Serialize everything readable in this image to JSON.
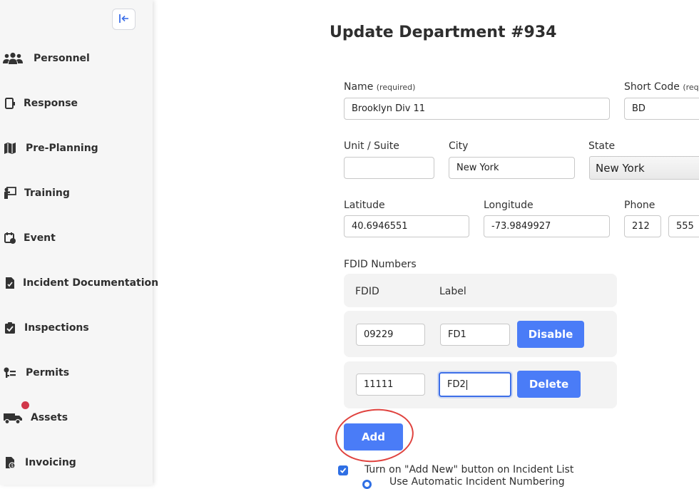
{
  "sidebar": {
    "collapse_icon": "collapse-left-icon",
    "items": [
      {
        "label": "Personnel",
        "icon": "people-icon"
      },
      {
        "label": "Response",
        "icon": "response-icon"
      },
      {
        "label": "Pre-Planning",
        "icon": "map-icon"
      },
      {
        "label": "Training",
        "icon": "training-icon"
      },
      {
        "label": "Event",
        "icon": "calendar-icon"
      },
      {
        "label": "Incident Documentation",
        "icon": "document-icon"
      },
      {
        "label": "Inspections",
        "icon": "clipboard-check-icon"
      },
      {
        "label": "Permits",
        "icon": "key-list-icon"
      },
      {
        "label": "Assets",
        "icon": "truck-icon"
      },
      {
        "label": "Invoicing",
        "icon": "invoice-icon"
      }
    ],
    "assets_badge_color": "#d1374a"
  },
  "page": {
    "title": "Update Department #934"
  },
  "form": {
    "name_label": "Name",
    "name_req": "(required)",
    "name_value": "Brooklyn Div 11",
    "short_code_label": "Short Code",
    "short_code_req": "(req",
    "short_code_value": "BD",
    "unit_label": "Unit / Suite",
    "unit_value": "",
    "city_label": "City",
    "city_value": "New York",
    "state_label": "State",
    "state_value": "New York",
    "latitude_label": "Latitude",
    "latitude_value": "40.6946551",
    "longitude_label": "Longitude",
    "longitude_value": "-73.9849927",
    "phone_label": "Phone",
    "phone_area": "212",
    "phone_prefix": "555"
  },
  "fdid": {
    "section_label": "FDID Numbers",
    "col_fdid": "FDID",
    "col_label": "Label",
    "rows": [
      {
        "fdid": "09229",
        "label": "FD1",
        "action": "Disable"
      },
      {
        "fdid": "11111",
        "label": "FD2",
        "action": "Delete"
      }
    ],
    "add_label": "Add"
  },
  "options": {
    "add_new_label": "Turn on \"Add New\" button on Incident List",
    "add_new_checked": true,
    "auto_numbering_label": "Use Automatic Incident Numbering"
  },
  "colors": {
    "accent": "#4a7cf7",
    "annotation": "#e0433f"
  }
}
